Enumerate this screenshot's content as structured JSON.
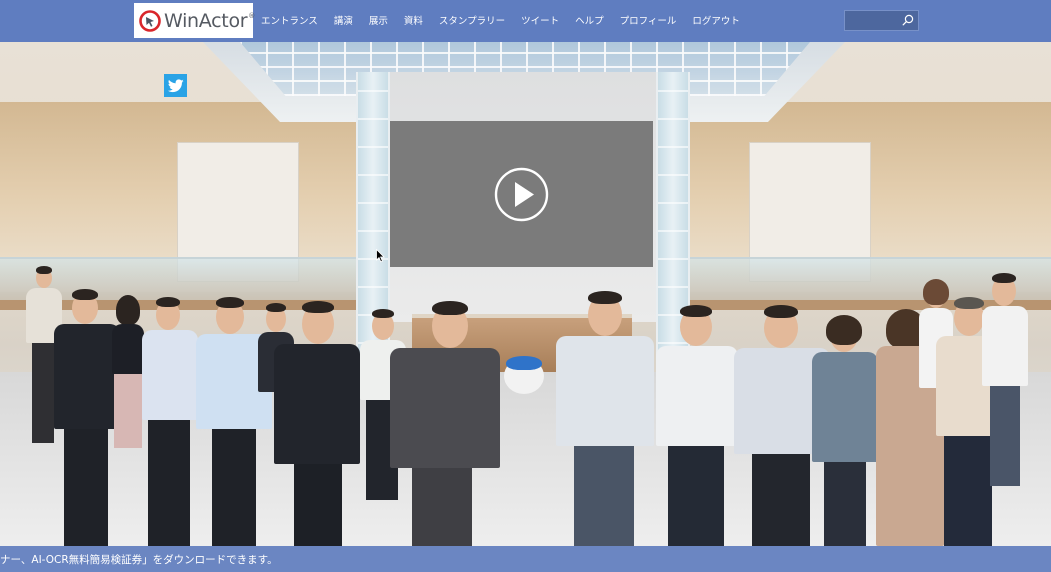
{
  "brand": {
    "logo_text": "WinActor",
    "registered_mark": "®"
  },
  "nav": {
    "items": [
      {
        "label": "エントランス"
      },
      {
        "label": "講演"
      },
      {
        "label": "展示"
      },
      {
        "label": "資料"
      },
      {
        "label": "スタンプラリー"
      },
      {
        "label": "ツイート"
      },
      {
        "label": "ヘルプ"
      },
      {
        "label": "プロフィール"
      },
      {
        "label": "ログアウト"
      }
    ]
  },
  "search": {
    "value": "",
    "placeholder": "",
    "icon": "search-icon"
  },
  "social": {
    "icon": "twitter-icon"
  },
  "video": {
    "icon": "play-icon"
  },
  "ticker": {
    "text": "ナー、AI-OCR無料簡易検証券」をダウンロードできます。"
  },
  "colors": {
    "nav_bar": "#5f7dc0",
    "ticker_bar": "#6b86c2",
    "twitter": "#2aa3e6",
    "video_bg": "#7b7b7b"
  }
}
